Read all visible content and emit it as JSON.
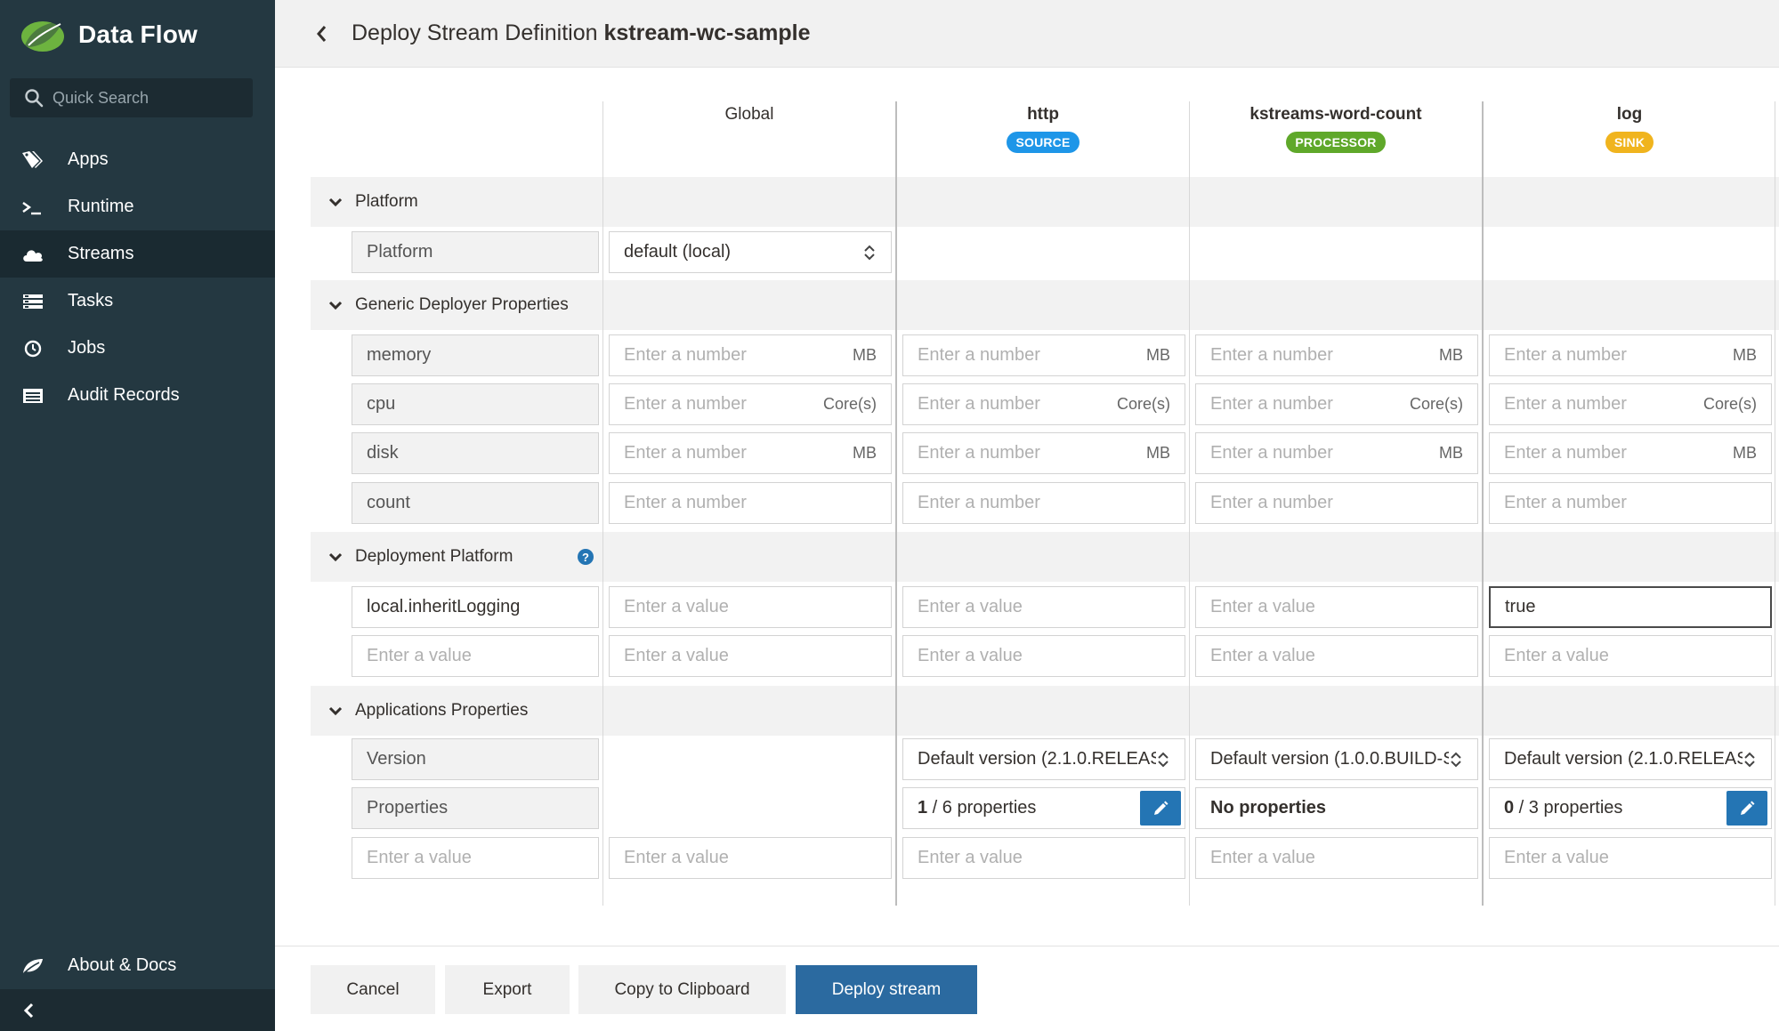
{
  "brand": {
    "title": "Data Flow"
  },
  "search": {
    "placeholder": "Quick Search"
  },
  "sidebar": {
    "items": [
      {
        "label": "Apps",
        "icon": "tags-icon",
        "active": false
      },
      {
        "label": "Runtime",
        "icon": "terminal-icon",
        "active": false
      },
      {
        "label": "Streams",
        "icon": "cloud-icon",
        "active": true
      },
      {
        "label": "Tasks",
        "icon": "list-icon",
        "active": false
      },
      {
        "label": "Jobs",
        "icon": "clock-icon",
        "active": false
      },
      {
        "label": "Audit Records",
        "icon": "records-icon",
        "active": false
      }
    ],
    "about": "About & Docs"
  },
  "header": {
    "title_prefix": "Deploy Stream Definition ",
    "title_stream": "kstream-wc-sample"
  },
  "columns": {
    "global": {
      "name": "Global"
    },
    "http": {
      "name": "http",
      "badge": "SOURCE",
      "badge_color": "#1e96e8"
    },
    "kwc": {
      "name": "kstreams-word-count",
      "badge": "PROCESSOR",
      "badge_color": "#5fa82a"
    },
    "log": {
      "name": "log",
      "badge": "SINK",
      "badge_color": "#f0b41e"
    }
  },
  "sections": {
    "platform": {
      "title": "Platform",
      "row_label": "Platform",
      "global_value": "default (local)"
    },
    "generic": {
      "title": "Generic Deployer Properties",
      "rows": [
        {
          "label": "memory",
          "placeholder": "Enter a number",
          "unit": "MB"
        },
        {
          "label": "cpu",
          "placeholder": "Enter a number",
          "unit": "Core(s)"
        },
        {
          "label": "disk",
          "placeholder": "Enter a number",
          "unit": "MB"
        },
        {
          "label": "count",
          "placeholder": "Enter a number",
          "unit": ""
        }
      ]
    },
    "deployment": {
      "title": "Deployment Platform",
      "help": "?",
      "row1_label": "local.inheritLogging",
      "value_placeholder": "Enter a value",
      "log_value": "true"
    },
    "applications": {
      "title": "Applications Properties",
      "version_label": "Version",
      "properties_label": "Properties",
      "value_placeholder": "Enter a value",
      "http_version": "Default version (2.1.0.RELEAS",
      "kwc_version": "Default version (1.0.0.BUILD-S",
      "log_version": "Default version (2.1.0.RELEAS",
      "http_props_count": "1",
      "http_props_text": " / 6 properties",
      "kwc_props": "No properties",
      "log_props_count": "0",
      "log_props_text": " / 3 properties"
    }
  },
  "footer": {
    "cancel": "Cancel",
    "export": "Export",
    "copy": "Copy to Clipboard",
    "deploy": "Deploy stream"
  }
}
